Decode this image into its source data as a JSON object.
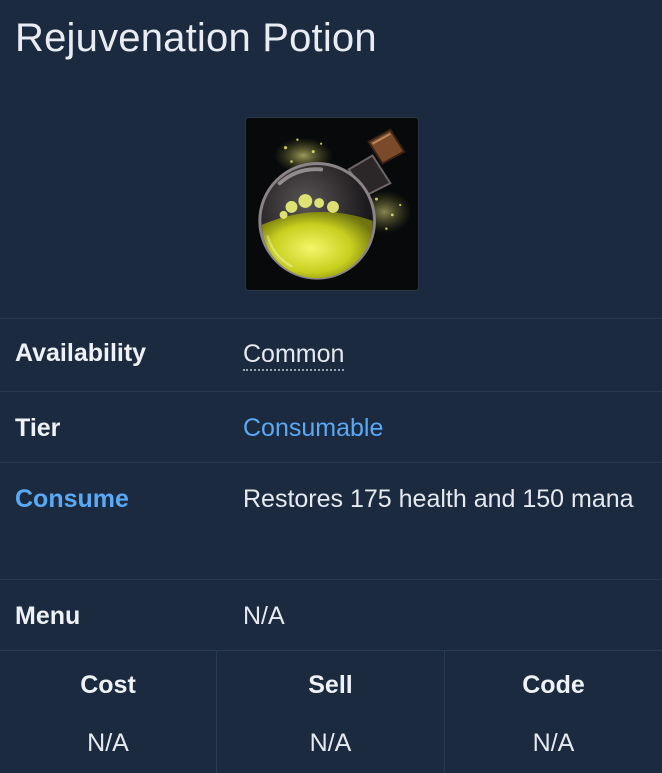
{
  "title": "Rejuvenation Potion",
  "image": {
    "icon": "rejuvenation-potion-flask-icon"
  },
  "rows": [
    {
      "label": "Availability",
      "value": "Common"
    },
    {
      "label": "Tier",
      "value": "Consumable"
    },
    {
      "label": "Consume",
      "value": "Restores 175 health and 150 mana"
    },
    {
      "label": "Menu",
      "value": "N/A"
    }
  ],
  "columns": [
    {
      "header": "Cost",
      "value": "N/A"
    },
    {
      "header": "Sell",
      "value": "N/A"
    },
    {
      "header": "Code",
      "value": "N/A"
    }
  ],
  "colors": {
    "background": "#1b2a3e",
    "link": "#5aa9f7",
    "divider": "#2a3a52"
  }
}
